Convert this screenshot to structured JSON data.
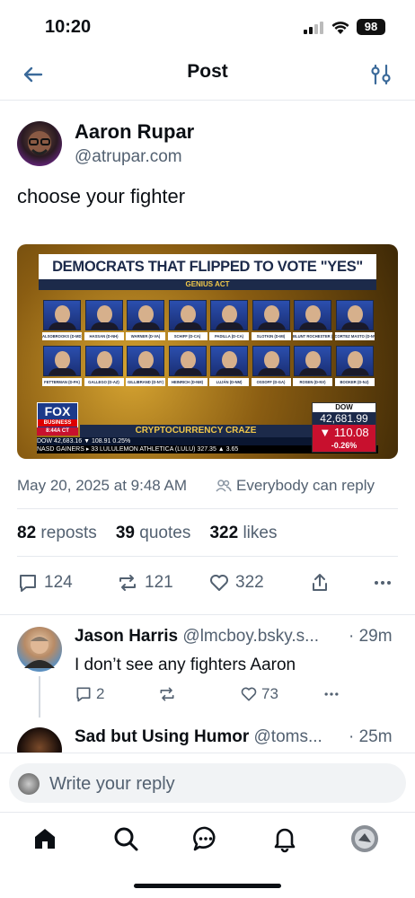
{
  "status_bar": {
    "time": "10:20",
    "battery": "98"
  },
  "header": {
    "title": "Post"
  },
  "post": {
    "author_name": "Aaron Rupar",
    "author_handle": "@atrupar.com",
    "text": "choose your fighter",
    "timestamp": "May 20, 2025 at 9:48 AM",
    "reply_permission": "Everybody can reply",
    "stats": {
      "reposts": "82",
      "reposts_label": "reposts",
      "quotes": "39",
      "quotes_label": "quotes",
      "likes": "322",
      "likes_label": "likes"
    },
    "actions": {
      "replies": "124",
      "reposts": "121",
      "likes": "322"
    }
  },
  "image": {
    "headline": "DEMOCRATS THAT FLIPPED TO VOTE \"YES\"",
    "subhead": "GENIUS ACT",
    "row1_captions": [
      "ALSOBROOKS (D-MD)",
      "HASSAN (D-NH)",
      "WARNER (D-VA)",
      "SCHIFF (D-CA)",
      "PADILLA (D-CA)",
      "SLOTKIN (D-MI)",
      "BLUNT ROCHESTER (D-DE)",
      "CORTEZ MASTO (D-NV)"
    ],
    "row2_captions": [
      "FETTERMAN (D-PA)",
      "GALLEGO (D-AZ)",
      "GILLIBRAND (D-NY)",
      "HEINRICH (D-NM)",
      "LUJÁN (D-NM)",
      "OSSOFF (D-GA)",
      "ROSEN (D-NV)",
      "BOOKER (D-NJ)"
    ],
    "logo": "FOX",
    "logo_sub": "BUSINESS",
    "live_time": "8:44A CT",
    "banner": "CRYPTOCURRENCY CRAZE",
    "ticker_line": "DOW   42,683.16 ▼ 108.91  0.25%",
    "ticker_line2": "NASD GAINERS ▸ 33   LULULEMON ATHLETICA (LULU)  327.35 ▲ 3.65",
    "dow_label": "DOW",
    "dow_value": "42,681.99",
    "dow_change": "▼ 110.08",
    "dow_pct": "-0.26%"
  },
  "replies": [
    {
      "name": "Jason Harris",
      "handle": "@lmcboy.bsky.s...",
      "time": "· 29m",
      "text": "I don’t see any fighters Aaron",
      "reply_count": "2",
      "like_count": "73"
    },
    {
      "name": "Sad but Using Humor",
      "handle": "@toms...",
      "time": "· 25m"
    }
  ],
  "compose": {
    "placeholder": "Write your reply"
  },
  "icons": {
    "back": "arrow-left-icon",
    "filter": "sliders-icon",
    "tabs": [
      "home-icon",
      "search-icon",
      "chat-icon",
      "bell-icon",
      "avatar-icon"
    ]
  },
  "colors": {
    "accent": "#1083fe",
    "muted": "#536171",
    "text": "#0b0f14"
  }
}
